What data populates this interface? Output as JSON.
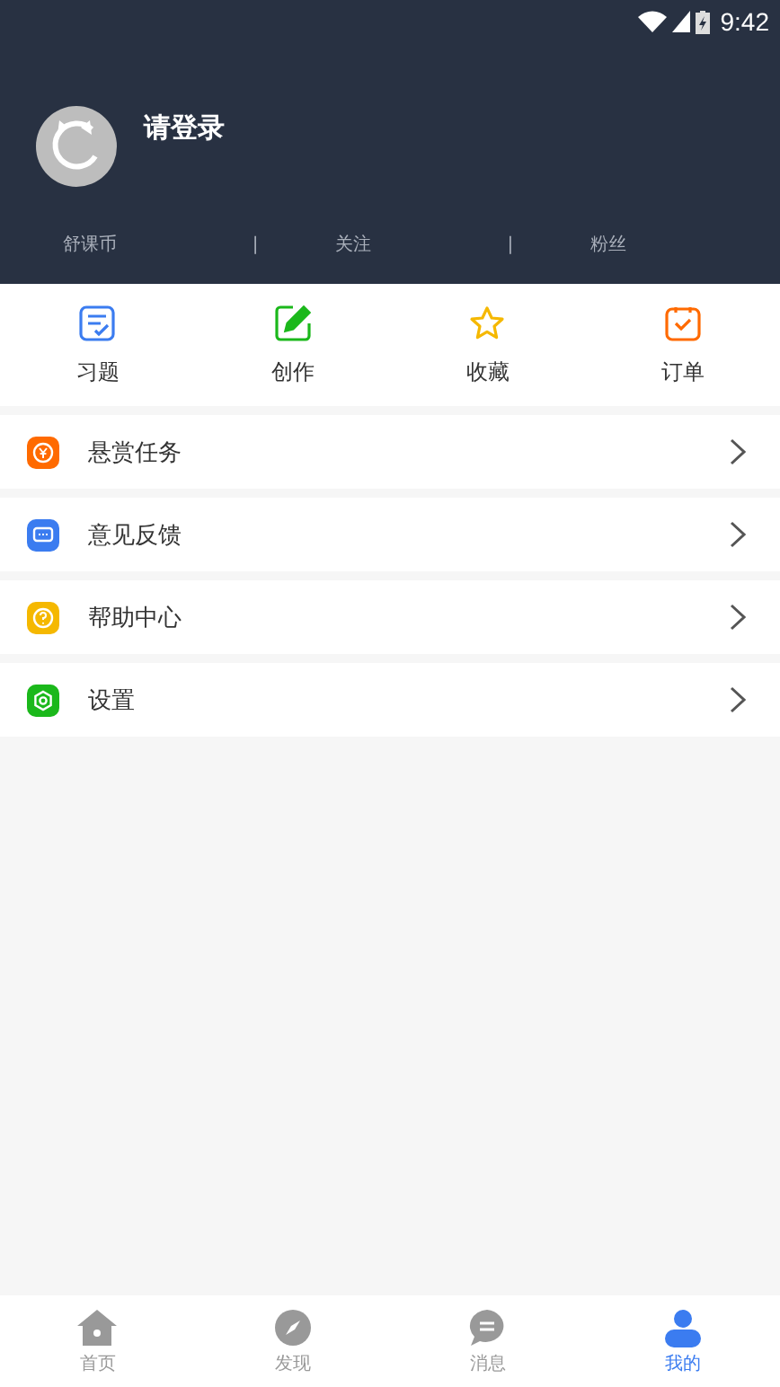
{
  "status_bar": {
    "time": "9:42"
  },
  "profile": {
    "name": "请登录",
    "stats": [
      "舒课币",
      "关注",
      "粉丝"
    ],
    "separator": "|"
  },
  "shortcuts": [
    {
      "kind": "exercise",
      "label": "习题"
    },
    {
      "kind": "create",
      "label": "创作"
    },
    {
      "kind": "favorite",
      "label": "收藏"
    },
    {
      "kind": "order",
      "label": "订单"
    }
  ],
  "menu": [
    {
      "kind": "reward",
      "label": "悬赏任务",
      "color": "#ff6a00"
    },
    {
      "kind": "feedback",
      "label": "意见反馈",
      "color": "#3b7cf0"
    },
    {
      "kind": "help",
      "label": "帮助中心",
      "color": "#f5b800"
    },
    {
      "kind": "settings",
      "label": "设置",
      "color": "#1bb81b"
    }
  ],
  "tabs": [
    {
      "kind": "home",
      "label": "首页",
      "selected": false
    },
    {
      "kind": "discover",
      "label": "发现",
      "selected": false
    },
    {
      "kind": "messages",
      "label": "消息",
      "selected": false
    },
    {
      "kind": "me",
      "label": "我的",
      "selected": true
    }
  ]
}
